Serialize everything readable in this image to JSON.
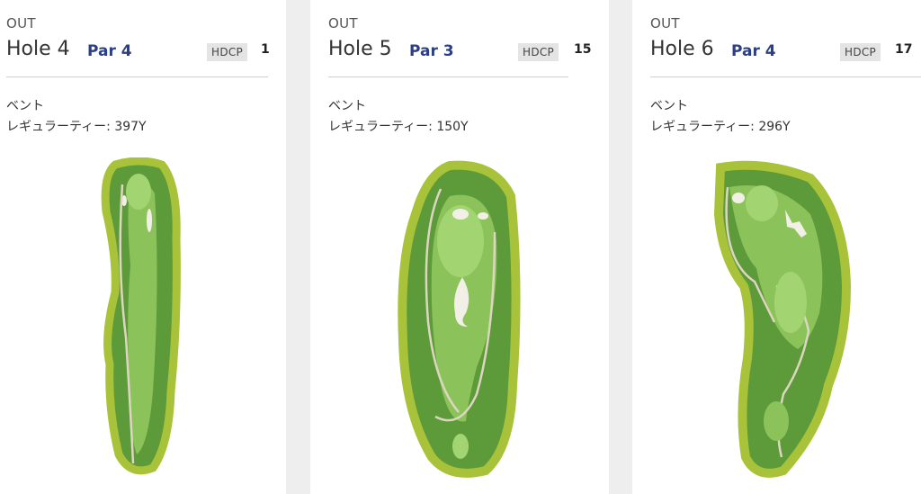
{
  "holes": [
    {
      "side": "OUT",
      "hole": "Hole 4",
      "par": "Par 4",
      "hdcp_label": "HDCP",
      "hdcp": "1",
      "green": "ベント",
      "tee": "レギュラーティー: 397Y"
    },
    {
      "side": "OUT",
      "hole": "Hole 5",
      "par": "Par 3",
      "hdcp_label": "HDCP",
      "hdcp": "15",
      "green": "ベント",
      "tee": "レギュラーティー: 150Y"
    },
    {
      "side": "OUT",
      "hole": "Hole 6",
      "par": "Par 4",
      "hdcp_label": "HDCP",
      "hdcp": "17",
      "green": "ベント",
      "tee": "レギュラーティー: 296Y"
    }
  ],
  "colors": {
    "par": "#2b3f86",
    "rough": "#5d9a3a",
    "fairway": "#8cc25a",
    "tree": "#a8c23a",
    "bunker": "#f2f0e6"
  }
}
